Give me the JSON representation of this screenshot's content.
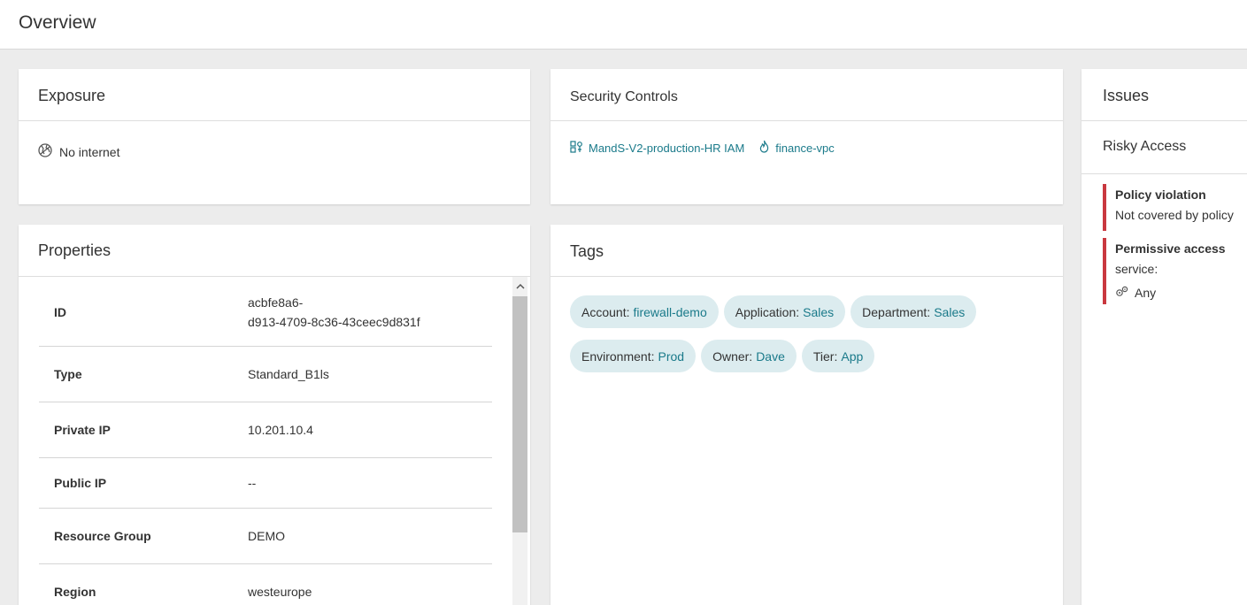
{
  "page": {
    "title": "Overview"
  },
  "exposure": {
    "title": "Exposure",
    "value": "No internet",
    "icon": "globe-icon"
  },
  "security_controls": {
    "title": "Security Controls",
    "links": [
      {
        "label": "MandS-V2-production-HR IAM",
        "icon": "iam-icon"
      },
      {
        "label": "finance-vpc",
        "icon": "fire-icon"
      }
    ]
  },
  "issues": {
    "title": "Issues",
    "risky_access": {
      "title": "Risky Access",
      "items": [
        {
          "title": "Policy violation",
          "detail": "Not covered by policy"
        },
        {
          "title": "Permissive access",
          "detail": "service:",
          "value": "Any"
        }
      ]
    },
    "accent_color": "#c9383f"
  },
  "properties": {
    "title": "Properties",
    "rows": [
      {
        "label": "ID",
        "value": "acbfe8a6-\nd913-4709-8c36-43ceec9d831f"
      },
      {
        "label": "Type",
        "value": "Standard_B1ls"
      },
      {
        "label": "Private IP",
        "value": "10.201.10.4"
      },
      {
        "label": "Public IP",
        "value": "--"
      },
      {
        "label": "Resource Group",
        "value": "DEMO"
      },
      {
        "label": "Region",
        "value": "westeurope"
      }
    ]
  },
  "tags": {
    "title": "Tags",
    "items": [
      {
        "key": "Account:",
        "value": "firewall-demo"
      },
      {
        "key": "Application:",
        "value": "Sales"
      },
      {
        "key": "Department:",
        "value": "Sales"
      },
      {
        "key": "Environment:",
        "value": "Prod"
      },
      {
        "key": "Owner:",
        "value": "Dave"
      },
      {
        "key": "Tier:",
        "value": "App"
      }
    ],
    "chip_color": "#dcecef",
    "value_color": "#1a7a8a"
  }
}
